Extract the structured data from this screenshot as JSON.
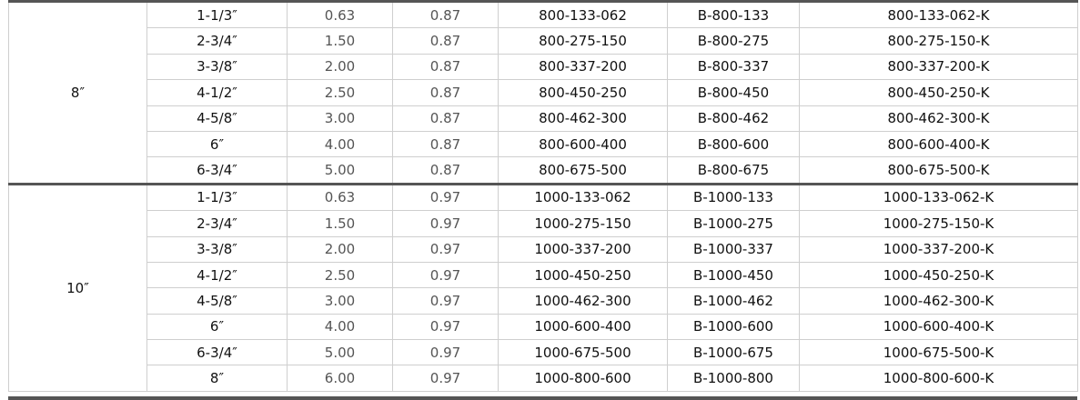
{
  "groups": [
    {
      "label": "8″",
      "rows": [
        [
          "1-1/3″",
          "0.63",
          "0.87",
          "800-133-062",
          "B-800-133",
          "800-133-062-K"
        ],
        [
          "2-3/4″",
          "1.50",
          "0.87",
          "800-275-150",
          "B-800-275",
          "800-275-150-K"
        ],
        [
          "3-3/8″",
          "2.00",
          "0.87",
          "800-337-200",
          "B-800-337",
          "800-337-200-K"
        ],
        [
          "4-1/2″",
          "2.50",
          "0.87",
          "800-450-250",
          "B-800-450",
          "800-450-250-K"
        ],
        [
          "4-5/8″",
          "3.00",
          "0.87",
          "800-462-300",
          "B-800-462",
          "800-462-300-K"
        ],
        [
          "6″",
          "4.00",
          "0.87",
          "800-600-400",
          "B-800-600",
          "800-600-400-K"
        ],
        [
          "6-3/4″",
          "5.00",
          "0.87",
          "800-675-500",
          "B-800-675",
          "800-675-500-K"
        ]
      ]
    },
    {
      "label": "10″",
      "rows": [
        [
          "1-1/3″",
          "0.63",
          "0.97",
          "1000-133-062",
          "B-1000-133",
          "1000-133-062-K"
        ],
        [
          "2-3/4″",
          "1.50",
          "0.97",
          "1000-275-150",
          "B-1000-275",
          "1000-275-150-K"
        ],
        [
          "3-3/8″",
          "2.00",
          "0.97",
          "1000-337-200",
          "B-1000-337",
          "1000-337-200-K"
        ],
        [
          "4-1/2″",
          "2.50",
          "0.97",
          "1000-450-250",
          "B-1000-450",
          "1000-450-250-K"
        ],
        [
          "4-5/8″",
          "3.00",
          "0.97",
          "1000-462-300",
          "B-1000-462",
          "1000-462-300-K"
        ],
        [
          "6″",
          "4.00",
          "0.97",
          "1000-600-400",
          "B-1000-600",
          "1000-600-400-K"
        ],
        [
          "6-3/4″",
          "5.00",
          "0.97",
          "1000-675-500",
          "B-1000-675",
          "1000-675-500-K"
        ],
        [
          "8″",
          "6.00",
          "0.97",
          "1000-800-600",
          "B-1000-800",
          "1000-800-600-K"
        ]
      ]
    }
  ]
}
